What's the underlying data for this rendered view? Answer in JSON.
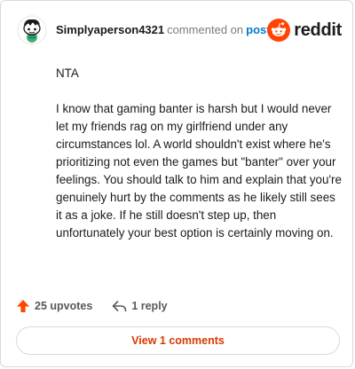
{
  "comment": {
    "author": "Simplyaperson4321",
    "action_text": "commented on",
    "post_link": "post",
    "paragraphs": [
      "NTA",
      "I know that gaming banter is harsh but I would never let my friends rag on my girlfriend under any circumstances lol. A world shouldn't exist where he's prioritizing not even the games but \"banter\" over your feelings. You should talk to him and explain that you're genuinely hurt by the comments as he likely still sees it as a joke. If he still doesn't step up, then unfortunately your best option is certainly moving on."
    ],
    "upvotes": "25 upvotes",
    "replies": "1 reply",
    "view_comments": "View 1 comments"
  },
  "brand": {
    "name": "reddit",
    "accent": "#ff4500",
    "upvote_color": "#ff4500",
    "view_button_text_color": "#d93a00",
    "link_color": "#0079d3"
  },
  "icons": {
    "avatar": "snoo-avatar-icon",
    "logo": "reddit-logo-icon",
    "upvote": "upvote-arrow-icon",
    "reply": "reply-arrow-icon"
  }
}
